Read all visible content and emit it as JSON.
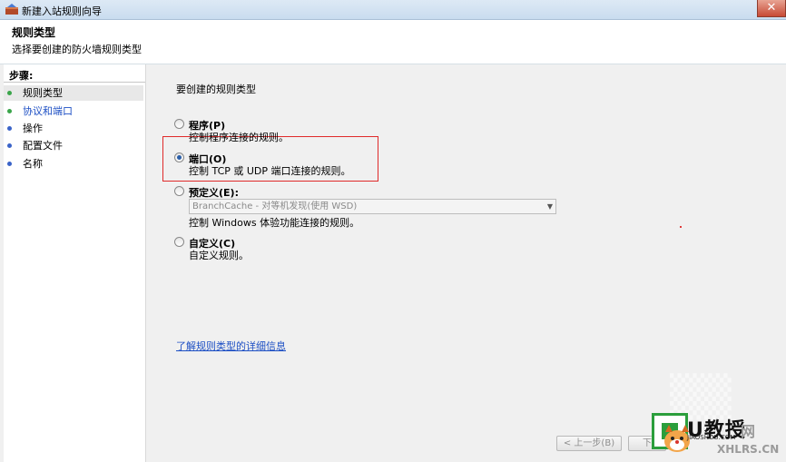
{
  "window": {
    "title": "新建入站规则向导",
    "close_label": "✕"
  },
  "header": {
    "title": "规则类型",
    "subtitle": "选择要创建的防火墙规则类型"
  },
  "sidebar": {
    "title": "步骤:",
    "items": [
      {
        "label": "规则类型",
        "state": "current",
        "dot_color": "#3aa54a"
      },
      {
        "label": "协议和端口",
        "state": "link",
        "dot_color": "#3aa54a"
      },
      {
        "label": "操作",
        "state": "normal",
        "dot_color": "#3a63c8"
      },
      {
        "label": "配置文件",
        "state": "normal",
        "dot_color": "#3a63c8"
      },
      {
        "label": "名称",
        "state": "normal",
        "dot_color": "#3a63c8"
      }
    ]
  },
  "main": {
    "prompt": "要创建的规则类型",
    "options": [
      {
        "label": "程序(P)",
        "desc": "控制程序连接的规则。",
        "checked": false
      },
      {
        "label": "端口(O)",
        "desc": "控制 TCP 或 UDP 端口连接的规则。",
        "checked": true
      },
      {
        "label": "预定义(E):",
        "desc": "控制 Windows 体验功能连接的规则。",
        "checked": false
      },
      {
        "label": "自定义(C)",
        "desc": "自定义规则。",
        "checked": false
      }
    ],
    "predefined_select": {
      "value": "BranchCache - 对等机发现(使用 WSD)"
    },
    "help_link": "了解规则类型的详细信息"
  },
  "buttons": {
    "back": "< 上一步(B)",
    "next": "下"
  },
  "watermark": {
    "brand": "U教授",
    "pinyin": "JIAOSHOU.COM",
    "net": "网",
    "site": "XHLRS.CN"
  },
  "colors": {
    "accent": "#2a5ea8",
    "highlight": "#e02a2a",
    "link": "#1d4fc4"
  }
}
